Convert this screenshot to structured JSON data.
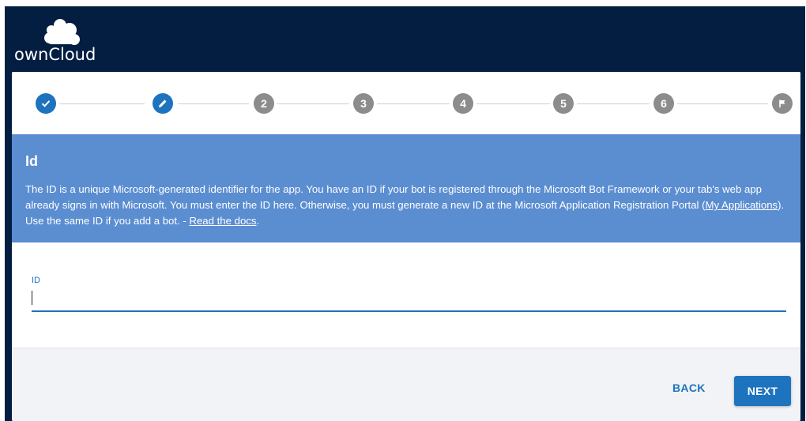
{
  "brand": {
    "name": "ownCloud"
  },
  "stepper": {
    "steps": [
      {
        "state": "done",
        "icon": "check-icon"
      },
      {
        "state": "current",
        "icon": "pencil-icon"
      },
      {
        "state": "todo",
        "label": "2"
      },
      {
        "state": "todo",
        "label": "3"
      },
      {
        "state": "todo",
        "label": "4"
      },
      {
        "state": "todo",
        "label": "5"
      },
      {
        "state": "todo",
        "label": "6"
      },
      {
        "state": "todo",
        "icon": "flag-icon"
      }
    ]
  },
  "info": {
    "title": "Id",
    "text_1": "The ID is a unique Microsoft-generated identifier for the app. You have an ID if your bot is registered through the Microsoft Bot Framework or your tab's web app already signs in with Microsoft. You must enter the ID here. Otherwise, you must generate a new ID at the Microsoft Application Registration Portal (",
    "link_1": "My Applications",
    "text_2": "). Use the same ID if you add a bot. - ",
    "link_2": "Read the docs",
    "text_3": "."
  },
  "form": {
    "id_label": "ID",
    "id_value": ""
  },
  "footer": {
    "back_label": "BACK",
    "next_label": "NEXT"
  },
  "colors": {
    "header_bg": "#041e42",
    "accent": "#1e73be",
    "info_bg": "#5b8dd1",
    "step_inactive": "#8c8c8c",
    "footer_bg": "#f1f3f6"
  }
}
